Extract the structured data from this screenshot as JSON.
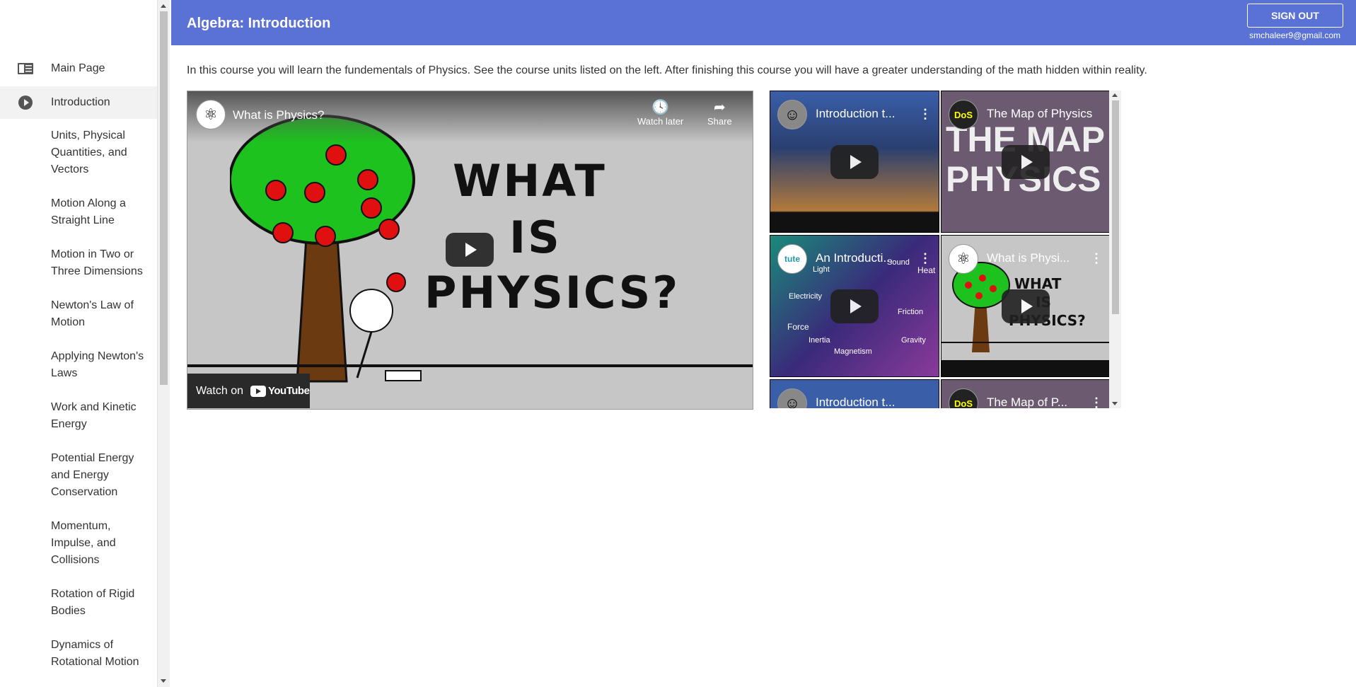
{
  "sidebar": {
    "main_page": "Main Page",
    "introduction": "Introduction",
    "units": [
      "Units, Physical Quantities, and Vectors",
      "Motion Along a Straight Line",
      "Motion in Two or Three Dimensions",
      "Newton's Law of Motion",
      "Applying Newton's Laws",
      "Work and Kinetic Energy",
      "Potential Energy and Energy Conservation",
      "Momentum, Impulse, and Collisions",
      "Rotation of Rigid Bodies",
      "Dynamics of Rotational Motion"
    ]
  },
  "header": {
    "title": "Algebra: Introduction",
    "signout": "SIGN OUT",
    "email": "smchaleer9@gmail.com",
    "color": "#5a71d6"
  },
  "content": {
    "description": "In this course you will learn the fundementals of Physics. See the course units listed on the left. After finishing this course you will have a greater understanding of the math hidden within reality."
  },
  "video": {
    "title": "What is Physics?",
    "watch_later": "Watch later",
    "share": "Share",
    "watch_on": "Watch on",
    "youtube": "YouTube",
    "thumb_words": [
      "WHAT",
      "IS",
      "PHYSICS?"
    ]
  },
  "thumbnails": [
    {
      "title": "Introduction t...",
      "icon": "person-avatar"
    },
    {
      "title": "The Map of Physics",
      "icon": "dos-logo",
      "art": "THE MAP PHYSICS"
    },
    {
      "title": "An Introducti...",
      "icon": "tute-logo",
      "tags": [
        "Light",
        "Sound",
        "Heat",
        "Electricity",
        "Friction",
        "Force",
        "Inertia",
        "Magnetism",
        "Gravity"
      ]
    },
    {
      "title": "What is Physi...",
      "icon": "atom-icon"
    },
    {
      "title": "Introduction t...",
      "icon": "person-avatar"
    },
    {
      "title": "The Map of P...",
      "icon": "dos-logo"
    }
  ]
}
